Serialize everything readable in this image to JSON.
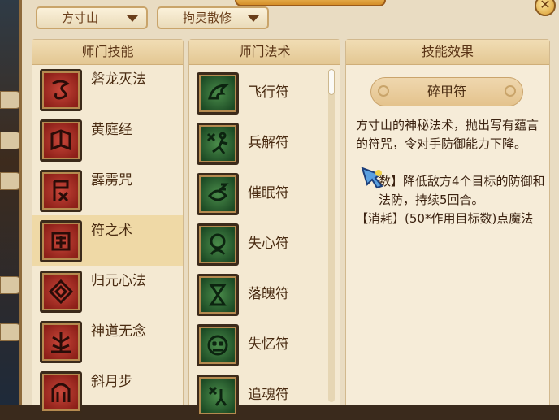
{
  "filters": {
    "school": "方寸山",
    "mode": "拘灵散修"
  },
  "panels": {
    "school_skills_header": "师门技能",
    "school_spells_header": "师门法术",
    "effect_header": "技能效果"
  },
  "school_skills": [
    {
      "label": "磐龙灭法",
      "icon": "dragon-rune-icon"
    },
    {
      "label": "黄庭经",
      "icon": "scroll-book-icon"
    },
    {
      "label": "霹雳咒",
      "icon": "thunder-rune-icon"
    },
    {
      "label": "符之术",
      "icon": "talisman-rune-icon",
      "selected": true
    },
    {
      "label": "归元心法",
      "icon": "circle-rune-icon"
    },
    {
      "label": "神道无念",
      "icon": "tree-rune-icon"
    },
    {
      "label": "斜月步",
      "icon": "moon-step-icon"
    }
  ],
  "school_spells": [
    {
      "label": "飞行符",
      "icon": "wing-talisman-icon"
    },
    {
      "label": "兵解符",
      "icon": "running-figure-icon"
    },
    {
      "label": "催眠符",
      "icon": "sleep-talisman-icon"
    },
    {
      "label": "失心符",
      "icon": "mask-face-icon"
    },
    {
      "label": "落魄符",
      "icon": "hourglass-figure-icon"
    },
    {
      "label": "失忆符",
      "icon": "forgetting-face-icon"
    },
    {
      "label": "追魂符",
      "icon": "chasing-figure-icon"
    }
  ],
  "effect": {
    "title": "碎甲符",
    "description": "方寸山的神秘法术，抛出写有蕴言的符咒，令对手防御能力下降。",
    "effect_line": "数】降低敌方4个目标的防御和法防，持续5回合。",
    "cost_line": "【消耗】(50*作用目标数)点魔法"
  },
  "colors": {
    "frame": "#e9dcc2",
    "panel": "#f4e9d2",
    "header": "#e3c793",
    "selected_row": "#efd9a6",
    "text": "#4a2c12"
  }
}
